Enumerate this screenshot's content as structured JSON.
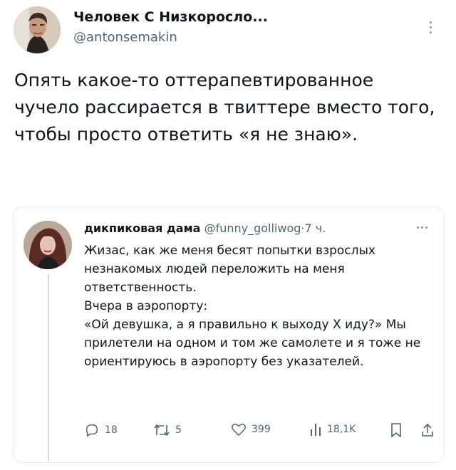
{
  "main": {
    "author_name": "Человек С Низкоросло...",
    "handle": "@antonsemakin",
    "text": "Опять какое-то оттерапевтированное чучело рассирается в твиттере вместо того, чтобы просто ответить «я не знаю»."
  },
  "reply": {
    "author_name": "дикпиковая дама",
    "handle": "@funny_golliwog",
    "dot": "·",
    "time": "7 ч.",
    "text_lines": [
      "Жизас, как же меня бесят попытки взрослых незнакомых людей переложить на меня ответственность.",
      "Вчера в аэропорту:",
      "«Ой девушка, а я правильно к выходу Х иду?» Мы прилетели на одном и том же самолете и я тоже не ориентируюсь в аэропорту без указателей."
    ],
    "actions": {
      "replies": "18",
      "retweets": "5",
      "likes": "399",
      "views": "18,1K"
    }
  },
  "icons": {
    "more_main": "more-vertical-icon",
    "more_reply": "more-horizontal-icon",
    "reply": "reply-icon",
    "retweet": "retweet-icon",
    "like": "heart-icon",
    "views": "views-icon",
    "bookmark": "bookmark-icon",
    "share": "share-icon"
  },
  "colors": {
    "text": "#0f1419",
    "secondary": "#536471",
    "border": "#e5e9ec"
  }
}
